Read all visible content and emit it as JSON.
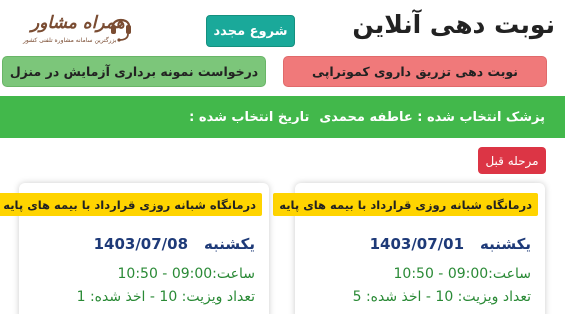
{
  "header": {
    "title": "نوبت دهی آنلاین",
    "restart_label": "شروع مجدد"
  },
  "logo": {
    "name": "همراه مشاور",
    "tagline": "بزرگترین سامانه مشاوره تلفنی کشور",
    "brand_color": "#7a4c32"
  },
  "services": {
    "chemo_label": "نوبت دهی تزریق داروی کموتراپی",
    "chemo_color": "#f0797a",
    "sample_label": "درخواست نمونه برداری آزمایش در منزل",
    "sample_color": "#7cc67a"
  },
  "info": {
    "doctor_text": "پزشک انتخاب شده : عاطفه محمدی",
    "date_text": "تاریخ انتخاب شده :",
    "bar_color": "#42b84b"
  },
  "nav": {
    "prev_label": "مرحله قبل"
  },
  "slots": [
    {
      "clinic": "درمانگاه شبانه روزی قرارداد با بیمه های پایه",
      "day": "یکشنبه",
      "date": "1403/07/01",
      "time": "ساعت:09:00 - 10:50",
      "count": "تعداد ویزیت: 10 - اخذ شده: 5"
    },
    {
      "clinic": "درمانگاه شبانه روزی قرارداد با بیمه های پایه",
      "day": "یکشنبه",
      "date": "1403/07/08",
      "time": "ساعت:09:00 - 10:50",
      "count": "تعداد ویزیت: 10 - اخذ شده: 1"
    }
  ]
}
